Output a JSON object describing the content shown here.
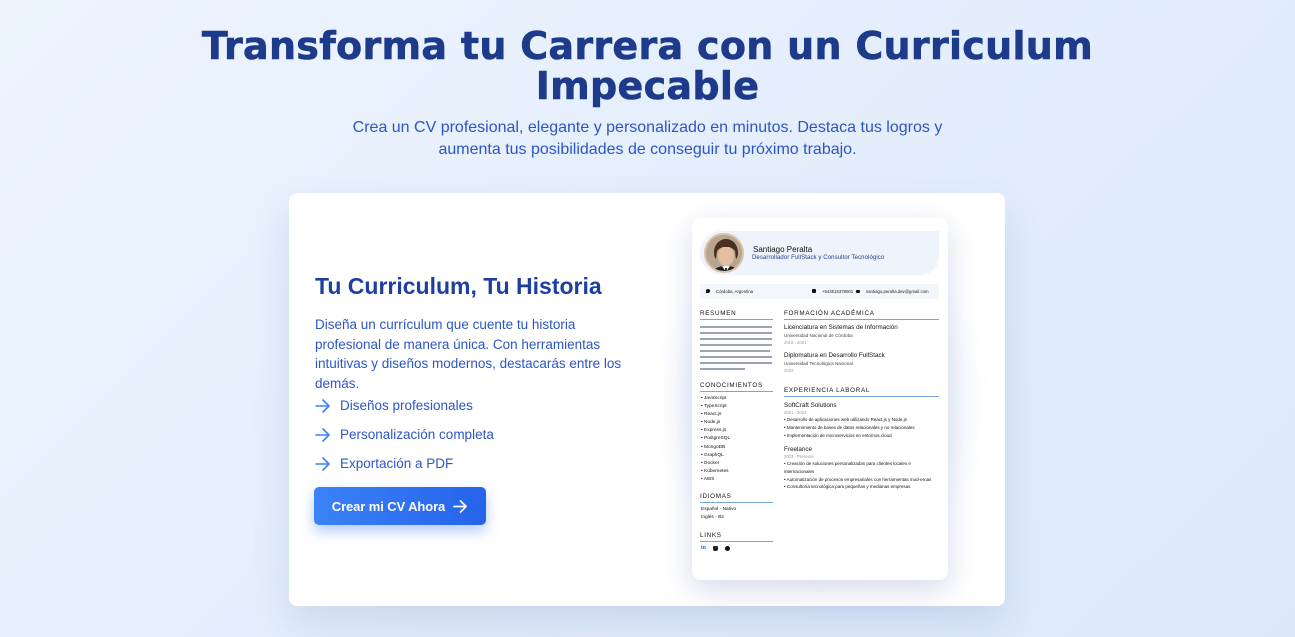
{
  "hero": {
    "title": "Transforma tu Carrera con un Curriculum Impecable",
    "subtitle": "Crea un CV profesional, elegante y personalizado en minutos. Destaca tus logros y aumenta tus posibilidades de conseguir tu próximo trabajo."
  },
  "card": {
    "title": "Tu Curriculum, Tu Historia",
    "description": "Diseña un currículum que cuente tu historia profesional de manera única. Con herramientas intuitivas y diseños modernos, destacarás entre los demás.",
    "features": [
      {
        "label": "Diseños profesionales",
        "icon": "arrow-right-icon"
      },
      {
        "label": "Personalización completa",
        "icon": "arrow-right-icon"
      },
      {
        "label": "Exportación a PDF",
        "icon": "arrow-right-icon"
      }
    ],
    "cta_label": "Crear mi CV Ahora",
    "accent_color": "#2563eb"
  },
  "cv": {
    "name": "Santiago Peralta",
    "role": "Desarrollador FullStack y Consultor Tecnológico",
    "contact": {
      "location": "Córdoba, Argentina",
      "phone": "+543515378001",
      "email": "santiago.peralta.dev@gmail.com"
    },
    "sections": {
      "summary": "RESUMEN",
      "skills": "CONOCIMIENTOS",
      "languages": "IDIOMAS",
      "links": "LINKS",
      "education": "FORMACIÓN ACADÉMICA",
      "experience": "EXPERIENCIA LABORAL"
    },
    "skills": [
      "• JavaScript",
      "• TypeScript",
      "• React.js",
      "• Node.js",
      "• Express.js",
      "• PostgreSQL",
      "• MongoDB",
      "• GraphQL",
      "• Docker",
      "• Kubernetes",
      "• AWS"
    ],
    "languages": [
      "Español - Nativo",
      "Inglés - B2"
    ],
    "education": [
      {
        "title": "Licenciatura en Sistemas de Información",
        "institution": "Universidad Nacional de Córdoba",
        "years": "2016 - 2021"
      },
      {
        "title": "Diplomatura en Desarrollo FullStack",
        "institution": "Universidad Tecnológica Nacional",
        "years": "2022"
      }
    ],
    "experience": [
      {
        "company": "SoftCraft Solutions",
        "years": "2021 - 2023",
        "bullets": [
          "• Desarrollo de aplicaciones web utilizando React.js y Node.js",
          "• Mantenimiento de bases de datos relacionales y no relacionales",
          "• Implementación de microservicios en entornos cloud"
        ]
      },
      {
        "company": "Freelance",
        "years": "2023 - Presente",
        "bullets": [
          "• Creación de soluciones personalizadas para clientes locales e internacionales",
          "• Automatización de procesos empresariales con herramientas mod-ernas",
          "• Consultoría tecnológica para pequeñas y medianas empresas"
        ]
      }
    ],
    "link_icons": [
      "linkedin-icon",
      "github-icon",
      "globe-icon"
    ]
  }
}
